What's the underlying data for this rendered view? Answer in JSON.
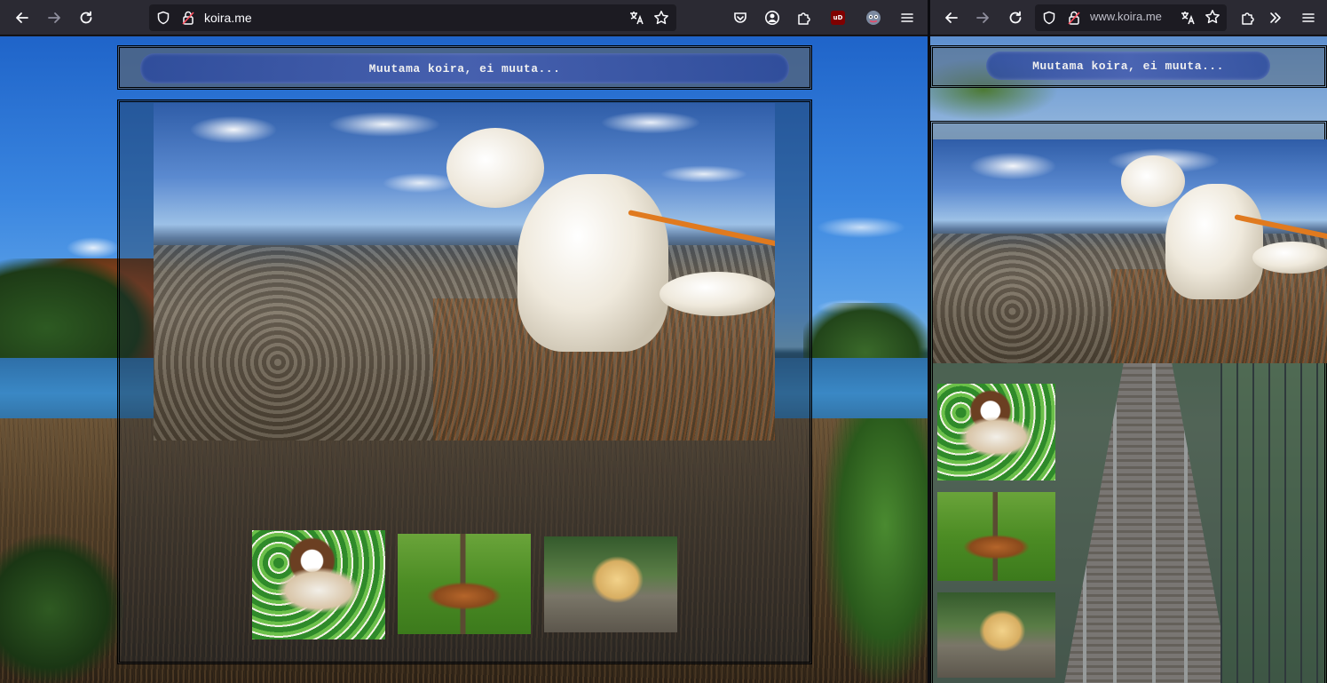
{
  "windows": [
    {
      "id": "left",
      "url_display": "koira.me",
      "header_text": "Muutama koira, ei muuta...",
      "extensions": {
        "ublock_label": "uD"
      }
    },
    {
      "id": "right",
      "url_display": "www.koira.me",
      "header_text": "Muutama koira, ei muuta..."
    }
  ],
  "icons": {
    "back": "back-arrow-icon",
    "forward": "forward-arrow-icon",
    "reload": "reload-icon",
    "shield": "tracking-protection-shield-icon",
    "lock": "insecure-lock-icon",
    "translate": "translate-icon",
    "bookmark": "star-icon",
    "pocket": "pocket-icon",
    "account": "account-icon",
    "extensions": "puzzle-icon",
    "ublock": "ublock-origin-icon",
    "profile": "profile-avatar-icon",
    "menu": "hamburger-menu-icon",
    "overflow": "chevron-double-right-icon"
  },
  "colors": {
    "toolbar_bg": "#2b2a33",
    "urlbar_bg": "#1c1b22",
    "header_pill": "#3c5aa8",
    "leash": "#e07a1f"
  }
}
